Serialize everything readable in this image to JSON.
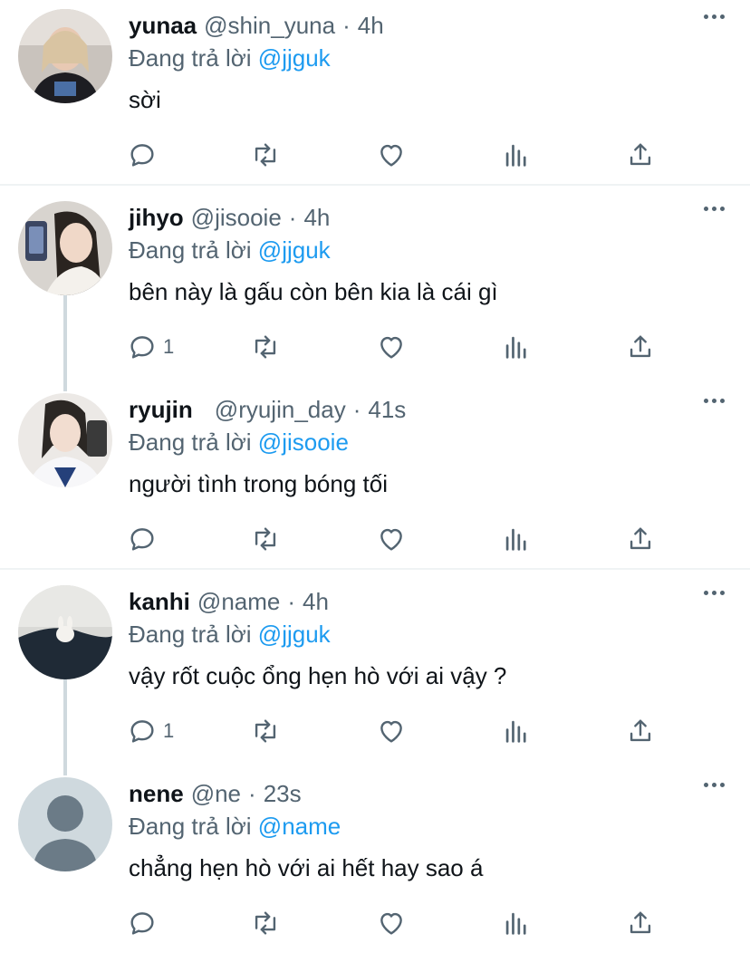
{
  "reply_prefix": "Đang trả lời",
  "tweets": [
    {
      "name": "yunaa",
      "handle": "@shin_yuna",
      "time": "4h",
      "reply_to": "@jjguk",
      "text": "sời",
      "reply_count": ""
    },
    {
      "name": "jihyo",
      "handle": "@jisooie",
      "time": "4h",
      "reply_to": "@jjguk",
      "text": "bên này là gấu còn bên kia là cái gì",
      "reply_count": "1"
    },
    {
      "name": "ryujin",
      "handle": "@ryujin_day",
      "time": "41s",
      "reply_to": "@jisooie",
      "text": "người tình trong bóng tối",
      "reply_count": ""
    },
    {
      "name": "kanhi",
      "handle": "@name",
      "time": "4h",
      "reply_to": "@jjguk",
      "text": "vậy rốt cuộc ổng hẹn hò với ai vậy ?",
      "reply_count": "1"
    },
    {
      "name": "nene",
      "handle": "@ne",
      "time": "23s",
      "reply_to": "@name",
      "text": "chẳng hẹn hò với ai hết hay sao á",
      "reply_count": ""
    }
  ],
  "colors": {
    "text": "#0f1419",
    "muted": "#536471",
    "link": "#1d9bf0",
    "divider": "#eff3f4",
    "thread": "#cfd9de"
  },
  "icons": [
    "reply-icon",
    "retweet-icon",
    "like-icon",
    "views-icon",
    "share-icon",
    "more-icon"
  ]
}
